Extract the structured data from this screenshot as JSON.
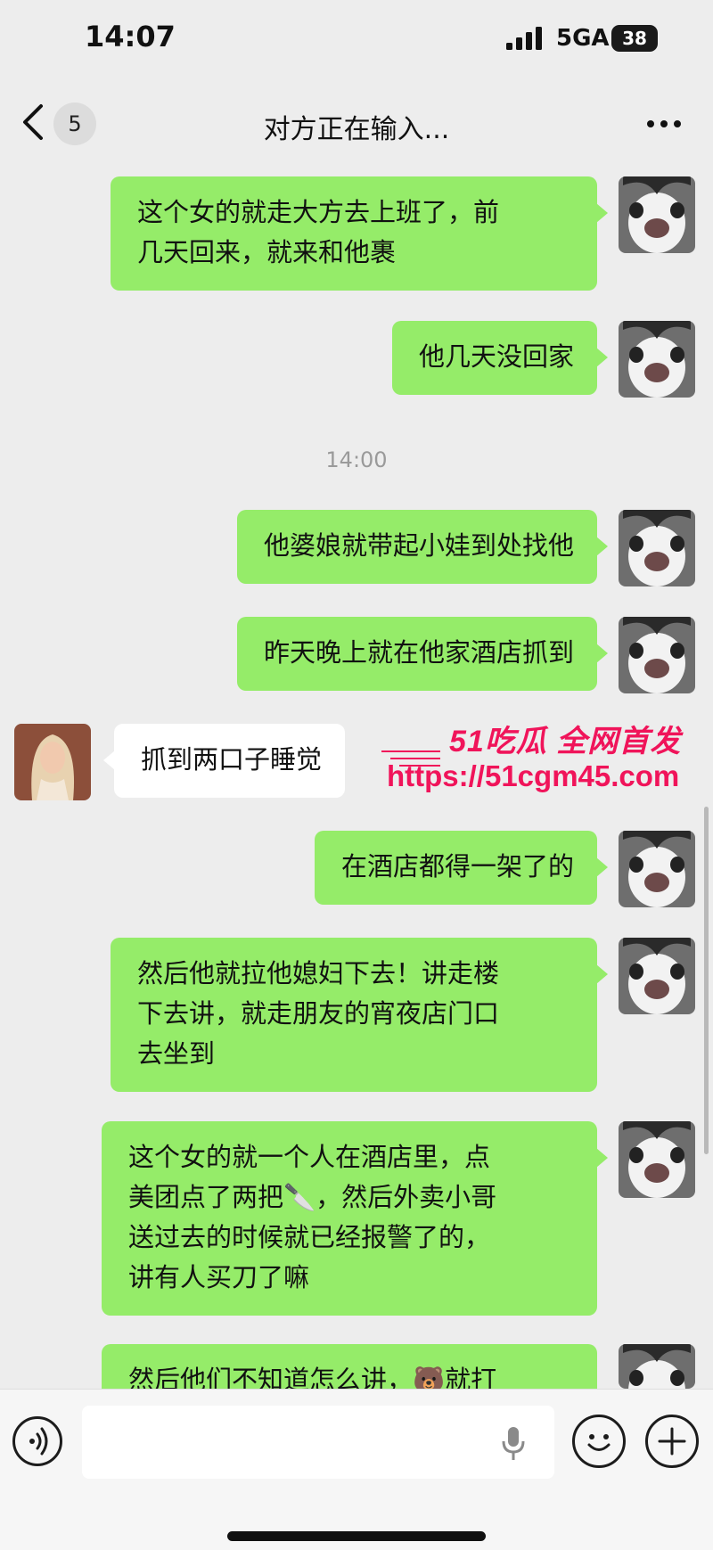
{
  "status_bar": {
    "time": "14:07",
    "network": "5GA",
    "battery": "38"
  },
  "nav": {
    "unread_count": "5",
    "title": "对方正在输入..."
  },
  "timestamp": "14:00",
  "messages": [
    {
      "sender": "me",
      "lines": [
        "这个女的就走大方去上班了，前",
        "几天回来，就来和他裹"
      ]
    },
    {
      "sender": "me",
      "lines": [
        "他几天没回家"
      ]
    },
    {
      "sender": "me",
      "lines": [
        "他婆娘就带起小娃到处找他"
      ]
    },
    {
      "sender": "me",
      "lines": [
        "昨天晚上就在他家酒店抓到"
      ]
    },
    {
      "sender": "them",
      "lines": [
        "抓到两口子睡觉"
      ]
    },
    {
      "sender": "me",
      "lines": [
        "在酒店都得一架了的"
      ]
    },
    {
      "sender": "me",
      "lines": [
        "然后他就拉他媳妇下去！讲走楼",
        "下去讲，就走朋友的宵夜店门口",
        "去坐到"
      ]
    },
    {
      "sender": "me",
      "lines": [
        "这个女的就一个人在酒店里，点",
        "美团点了两把🔪，然后外卖小哥",
        "送过去的时候就已经报警了的，",
        "讲有人买刀了嘛"
      ]
    },
    {
      "sender": "me",
      "lines": [
        "然后他们不知道怎么讲，🐻就打"
      ]
    }
  ],
  "watermark": {
    "brand": "51吃瓜 全网首发",
    "url": "https://51cgm45.com"
  },
  "input": {
    "value": "",
    "placeholder": ""
  },
  "colors": {
    "sent_bubble": "#95ec69",
    "received_bubble": "#ffffff",
    "background": "#ededed",
    "watermark": "#f0145a"
  }
}
